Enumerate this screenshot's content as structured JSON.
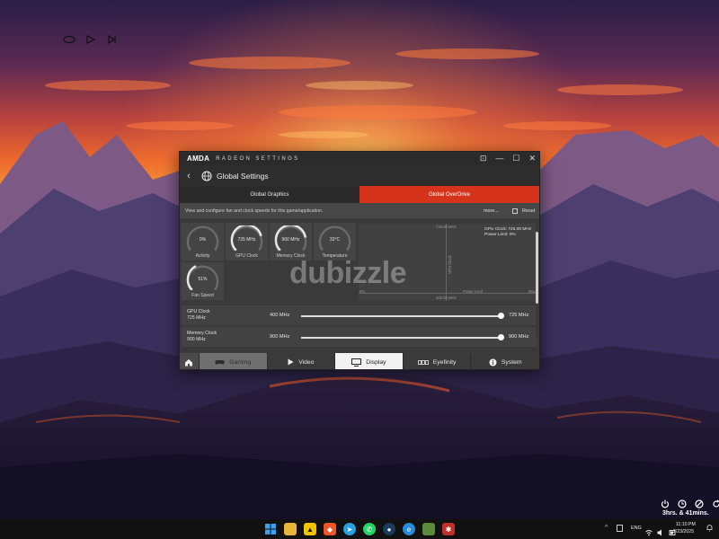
{
  "window": {
    "brand": "AMDA",
    "app_title": "RADEON SETTINGS",
    "controls": [
      "⊡",
      "—",
      "☐",
      "✕"
    ],
    "back_glyph": "‹",
    "page_title": "Global Settings"
  },
  "tabs": [
    {
      "label": "Global Graphics",
      "active": false
    },
    {
      "label": "Global OverDrive",
      "active": true
    }
  ],
  "description": {
    "text": "View and configure fan and clock speeds for this game/application.",
    "more_label": "more...",
    "reset_label": "Reset"
  },
  "gauges": [
    {
      "value": "0%",
      "label": "Activity",
      "level": 0.0
    },
    {
      "value": "725 MHz",
      "label": "GPU Clock",
      "level": 0.78
    },
    {
      "value": "900 MHz",
      "label": "Memory Clock",
      "level": 0.8
    },
    {
      "value": "33°C",
      "label": "Temperature",
      "level": 0.0
    },
    {
      "value": "51%",
      "label": "Fan Speed",
      "level": 0.4
    }
  ],
  "graph": {
    "top_label": "725.00 MHz",
    "bottom_label": "400.00 MHz",
    "axis_left": "0%",
    "axis_right": "Max",
    "vertical_label": "GPU Clock",
    "horizontal_label": "Power Limit",
    "info_gpu_clock": "GPU Clock: 725.00 MHz",
    "info_power_limit": "Power Limit: 0%"
  },
  "sliders": [
    {
      "name": "GPU Clock",
      "current": "725 MHz",
      "min": "400 MHz",
      "max": "725 MHz",
      "level": 1.0
    },
    {
      "name": "Memory Clock",
      "current": "900 MHz",
      "min": "900 MHz",
      "max": "900 MHz",
      "level": 1.0
    }
  ],
  "nav": {
    "home_icon": "home-icon",
    "items": [
      {
        "label": "Gaming",
        "icon": "gamepad-icon"
      },
      {
        "label": "Video",
        "icon": "play-icon"
      },
      {
        "label": "Display",
        "icon": "monitor-icon",
        "active": true
      },
      {
        "label": "Eyefinity",
        "icon": "eyefinity-icon"
      },
      {
        "label": "System",
        "icon": "info-icon"
      }
    ]
  },
  "watermark": "dubizzle",
  "widgets": {
    "battery_remaining": "3hrs. & 41mins."
  },
  "taskbar": {
    "language": "ENG",
    "time": "11:10 PM",
    "date": "2/23/2025",
    "chevron": "^"
  },
  "colors": {
    "accent": "#d5341b",
    "window_bg": "#3a3a3a",
    "taskbar_bg": "#111111"
  }
}
